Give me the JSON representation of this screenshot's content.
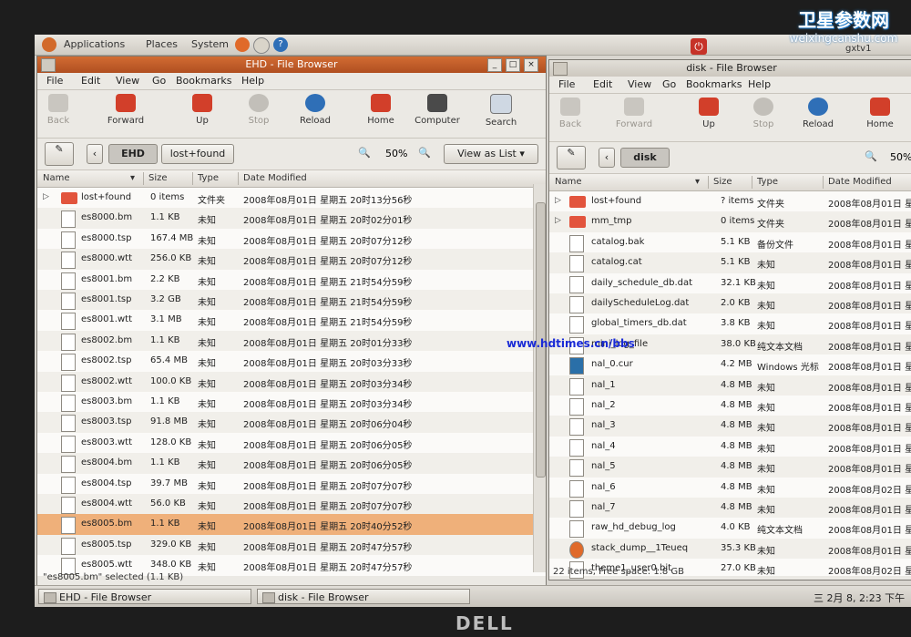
{
  "brand": {
    "line1": "卫星参数网",
    "line2": "weixingcanshu.com"
  },
  "watermark": "www.hdtimes.cn/bbs",
  "monitor_brand": "DELL",
  "top_panel": {
    "menus": [
      "Applications",
      "Places",
      "System"
    ],
    "user": "gxtv1"
  },
  "left_window": {
    "title": "EHD - File Browser",
    "menu": [
      "File",
      "Edit",
      "View",
      "Go",
      "Bookmarks",
      "Help"
    ],
    "toolbar": {
      "back": "Back",
      "forward": "Forward",
      "up": "Up",
      "stop": "Stop",
      "reload": "Reload",
      "home": "Home",
      "computer": "Computer",
      "search": "Search"
    },
    "location": {
      "current": "EHD",
      "folder": "lost+found",
      "zoom": "50%",
      "view_mode": "View as List"
    },
    "columns": {
      "name": "Name",
      "size": "Size",
      "type": "Type",
      "date": "Date Modified"
    },
    "rows": [
      {
        "name": "lost+found",
        "size": "0 items",
        "type": "文件夹",
        "date": "2008年08月01日 星期五 20时13分56秒",
        "kind": "folder"
      },
      {
        "name": "es8000.bm",
        "size": "1.1 KB",
        "type": "未知",
        "date": "2008年08月01日 星期五 20时02分01秒",
        "kind": "file"
      },
      {
        "name": "es8000.tsp",
        "size": "167.4 MB",
        "type": "未知",
        "date": "2008年08月01日 星期五 20时07分12秒",
        "kind": "file"
      },
      {
        "name": "es8000.wtt",
        "size": "256.0 KB",
        "type": "未知",
        "date": "2008年08月01日 星期五 20时07分12秒",
        "kind": "file"
      },
      {
        "name": "es8001.bm",
        "size": "2.2 KB",
        "type": "未知",
        "date": "2008年08月01日 星期五 21时54分59秒",
        "kind": "file"
      },
      {
        "name": "es8001.tsp",
        "size": "3.2 GB",
        "type": "未知",
        "date": "2008年08月01日 星期五 21时54分59秒",
        "kind": "file"
      },
      {
        "name": "es8001.wtt",
        "size": "3.1 MB",
        "type": "未知",
        "date": "2008年08月01日 星期五 21时54分59秒",
        "kind": "file"
      },
      {
        "name": "es8002.bm",
        "size": "1.1 KB",
        "type": "未知",
        "date": "2008年08月01日 星期五 20时01分33秒",
        "kind": "file"
      },
      {
        "name": "es8002.tsp",
        "size": "65.4 MB",
        "type": "未知",
        "date": "2008年08月01日 星期五 20时03分33秒",
        "kind": "file"
      },
      {
        "name": "es8002.wtt",
        "size": "100.0 KB",
        "type": "未知",
        "date": "2008年08月01日 星期五 20时03分34秒",
        "kind": "file"
      },
      {
        "name": "es8003.bm",
        "size": "1.1 KB",
        "type": "未知",
        "date": "2008年08月01日 星期五 20时03分34秒",
        "kind": "file"
      },
      {
        "name": "es8003.tsp",
        "size": "91.8 MB",
        "type": "未知",
        "date": "2008年08月01日 星期五 20时06分04秒",
        "kind": "file"
      },
      {
        "name": "es8003.wtt",
        "size": "128.0 KB",
        "type": "未知",
        "date": "2008年08月01日 星期五 20时06分05秒",
        "kind": "file"
      },
      {
        "name": "es8004.bm",
        "size": "1.1 KB",
        "type": "未知",
        "date": "2008年08月01日 星期五 20时06分05秒",
        "kind": "file"
      },
      {
        "name": "es8004.tsp",
        "size": "39.7 MB",
        "type": "未知",
        "date": "2008年08月01日 星期五 20时07分07秒",
        "kind": "file"
      },
      {
        "name": "es8004.wtt",
        "size": "56.0 KB",
        "type": "未知",
        "date": "2008年08月01日 星期五 20时07分07秒",
        "kind": "file"
      },
      {
        "name": "es8005.bm",
        "size": "1.1 KB",
        "type": "未知",
        "date": "2008年08月01日 星期五 20时40分52秒",
        "kind": "file",
        "selected": true
      },
      {
        "name": "es8005.tsp",
        "size": "329.0 KB",
        "type": "未知",
        "date": "2008年08月01日 星期五 20时47分57秒",
        "kind": "file"
      },
      {
        "name": "es8005.wtt",
        "size": "348.0 KB",
        "type": "未知",
        "date": "2008年08月01日 星期五 20时47分57秒",
        "kind": "file"
      }
    ],
    "status": "\"es8005.bm\" selected (1.1 KB)"
  },
  "right_window": {
    "title": "disk - File Browser",
    "menu": [
      "File",
      "Edit",
      "View",
      "Go",
      "Bookmarks",
      "Help"
    ],
    "toolbar": {
      "back": "Back",
      "forward": "Forward",
      "up": "Up",
      "stop": "Stop",
      "reload": "Reload",
      "home": "Home"
    },
    "location": {
      "current": "disk",
      "zoom": "50%"
    },
    "columns": {
      "name": "Name",
      "size": "Size",
      "type": "Type",
      "date": "Date Modified"
    },
    "rows": [
      {
        "name": "lost+found",
        "size": "? items",
        "type": "文件夹",
        "date": "2008年08月01日 星",
        "kind": "folder"
      },
      {
        "name": "mm_tmp",
        "size": "0 items",
        "type": "文件夹",
        "date": "2008年08月01日 星",
        "kind": "folder"
      },
      {
        "name": "catalog.bak",
        "size": "5.1 KB",
        "type": "备份文件",
        "date": "2008年08月01日 星",
        "kind": "file"
      },
      {
        "name": "catalog.cat",
        "size": "5.1 KB",
        "type": "未知",
        "date": "2008年08月01日 星",
        "kind": "file"
      },
      {
        "name": "daily_schedule_db.dat",
        "size": "32.1 KB",
        "type": "未知",
        "date": "2008年08月01日 星",
        "kind": "file"
      },
      {
        "name": "dailyScheduleLog.dat",
        "size": "2.0 KB",
        "type": "未知",
        "date": "2008年08月01日 星",
        "kind": "file"
      },
      {
        "name": "global_timers_db.dat",
        "size": "3.8 KB",
        "type": "未知",
        "date": "2008年08月01日 星",
        "kind": "file"
      },
      {
        "name": "mini_log_file",
        "size": "38.0 KB",
        "type": "纯文本文档",
        "date": "2008年08月01日 星",
        "kind": "file"
      },
      {
        "name": "nal_0.cur",
        "size": "4.2 MB",
        "type": "Windows 光标",
        "date": "2008年08月01日 星",
        "kind": "cursor"
      },
      {
        "name": "nal_1",
        "size": "4.8 MB",
        "type": "未知",
        "date": "2008年08月01日 星",
        "kind": "file"
      },
      {
        "name": "nal_2",
        "size": "4.8 MB",
        "type": "未知",
        "date": "2008年08月01日 星",
        "kind": "file"
      },
      {
        "name": "nal_3",
        "size": "4.8 MB",
        "type": "未知",
        "date": "2008年08月01日 星",
        "kind": "file"
      },
      {
        "name": "nal_4",
        "size": "4.8 MB",
        "type": "未知",
        "date": "2008年08月01日 星",
        "kind": "file"
      },
      {
        "name": "nal_5",
        "size": "4.8 MB",
        "type": "未知",
        "date": "2008年08月01日 星",
        "kind": "file"
      },
      {
        "name": "nal_6",
        "size": "4.8 MB",
        "type": "未知",
        "date": "2008年08月02日 星",
        "kind": "file"
      },
      {
        "name": "nal_7",
        "size": "4.8 MB",
        "type": "未知",
        "date": "2008年08月01日 星",
        "kind": "file"
      },
      {
        "name": "raw_hd_debug_log",
        "size": "4.0 KB",
        "type": "纯文本文档",
        "date": "2008年08月01日 星",
        "kind": "file"
      },
      {
        "name": "stack_dump__1Teueq",
        "size": "35.3 KB",
        "type": "未知",
        "date": "2008年08月01日 星",
        "kind": "special"
      },
      {
        "name": "theme1_user0.bit",
        "size": "27.0 KB",
        "type": "未知",
        "date": "2008年08月02日 星",
        "kind": "file"
      }
    ],
    "status": "22 items, Free space: 1.8 GB"
  },
  "taskbar": {
    "tasks": [
      "EHD - File Browser",
      "disk - File Browser"
    ],
    "clock": "三 2月 8, 2:23 下午"
  }
}
